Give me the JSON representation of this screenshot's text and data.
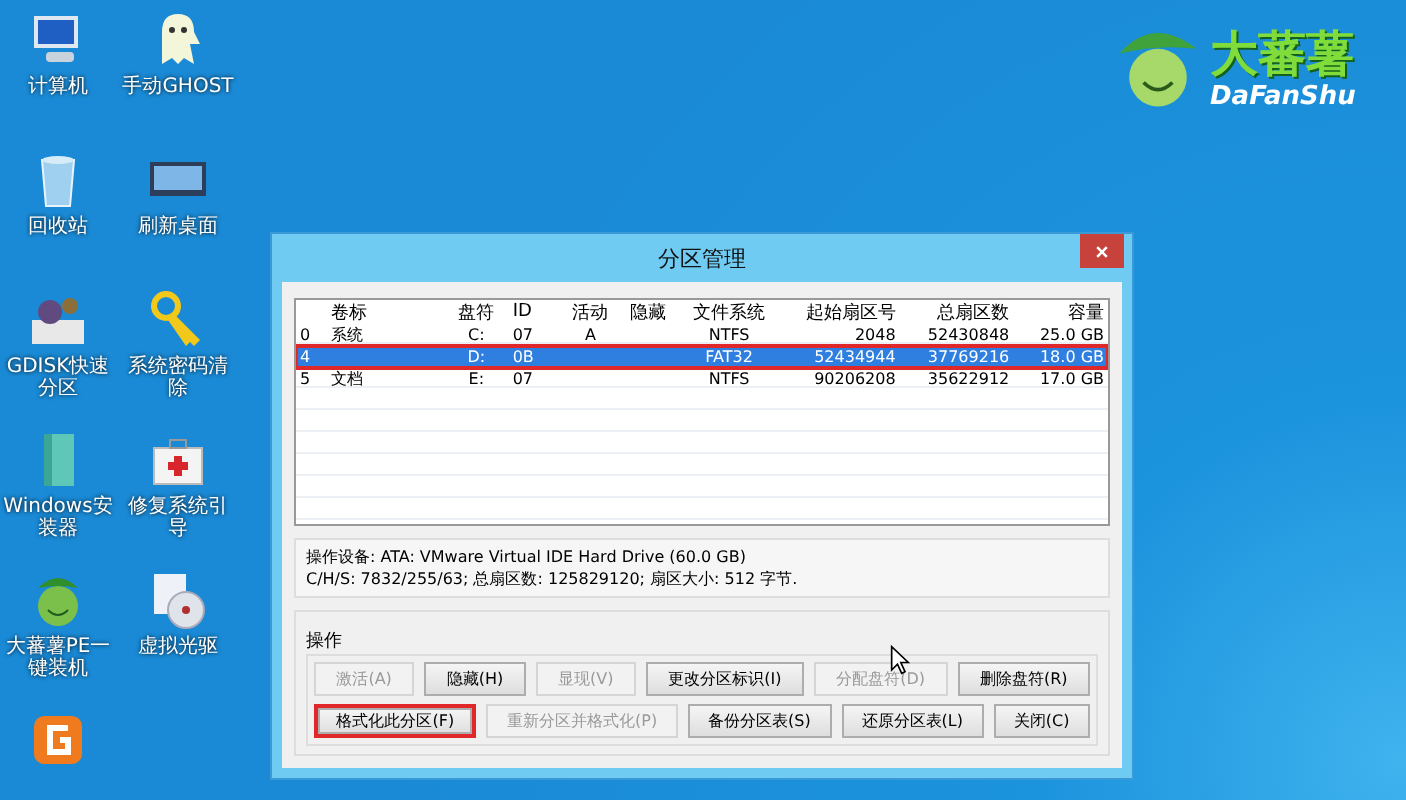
{
  "desktop_icons": [
    {
      "kind": "computer",
      "label": "计算机"
    },
    {
      "kind": "ghost",
      "label": "手动GHOST"
    },
    {
      "kind": "recycle-bin",
      "label": "回收站"
    },
    {
      "kind": "monitor",
      "label": "刷新桌面"
    },
    {
      "kind": "disk-tool",
      "label": "GDISK快速分区"
    },
    {
      "kind": "key",
      "label": "系统密码清除"
    },
    {
      "kind": "installer",
      "label": "Windows安装器"
    },
    {
      "kind": "first-aid",
      "label": "修复系统引导"
    },
    {
      "kind": "mascot",
      "label": "大蕃薯PE一键装机"
    },
    {
      "kind": "disc",
      "label": "虚拟光驱"
    },
    {
      "kind": "app"
    }
  ],
  "logo": {
    "title": "大蕃薯",
    "subtitle": "DaFanShu"
  },
  "dialog": {
    "title": "分区管理",
    "table": {
      "columns": [
        "",
        "卷标",
        "盘符",
        "ID",
        "活动",
        "隐藏",
        "文件系统",
        "起始扇区号",
        "总扇区数",
        "容量"
      ],
      "rows": [
        {
          "cells": [
            "0",
            "系统",
            "C:",
            "07",
            "A",
            "",
            "NTFS",
            "2048",
            "52430848",
            "25.0 GB"
          ],
          "selected": false,
          "highlighted": false
        },
        {
          "cells": [
            "4",
            "",
            "D:",
            "0B",
            "",
            "",
            "FAT32",
            "52434944",
            "37769216",
            "18.0 GB"
          ],
          "selected": true,
          "highlighted": true
        },
        {
          "cells": [
            "5",
            "文档",
            "E:",
            "07",
            "",
            "",
            "NTFS",
            "90206208",
            "35622912",
            "17.0 GB"
          ],
          "selected": false,
          "highlighted": false
        }
      ]
    },
    "device_info": [
      "操作设备:  ATA: VMware Virtual IDE Hard Drive (60.0 GB)",
      "C/H/S: 7832/255/63; 总扇区数: 125829120; 扇区大小: 512 字节."
    ],
    "operations_label": "操作",
    "button_rows": [
      [
        {
          "label": "激活(A)",
          "disabled": true,
          "highlighted": false
        },
        {
          "label": "隐藏(H)",
          "disabled": false,
          "highlighted": false
        },
        {
          "label": "显现(V)",
          "disabled": true,
          "highlighted": false
        },
        {
          "label": "更改分区标识(I)",
          "disabled": false,
          "highlighted": false
        },
        {
          "label": "分配盘符(D)",
          "disabled": true,
          "highlighted": false
        },
        {
          "label": "删除盘符(R)",
          "disabled": false,
          "highlighted": false
        }
      ],
      [
        {
          "label": "格式化此分区(F)",
          "disabled": false,
          "highlighted": true
        },
        {
          "label": "重新分区并格式化(P)",
          "disabled": true,
          "highlighted": false
        },
        {
          "label": "备份分区表(S)",
          "disabled": false,
          "highlighted": false
        },
        {
          "label": "还原分区表(L)",
          "disabled": false,
          "highlighted": false
        },
        {
          "label": "关闭(C)",
          "disabled": false,
          "highlighted": false
        }
      ]
    ]
  }
}
